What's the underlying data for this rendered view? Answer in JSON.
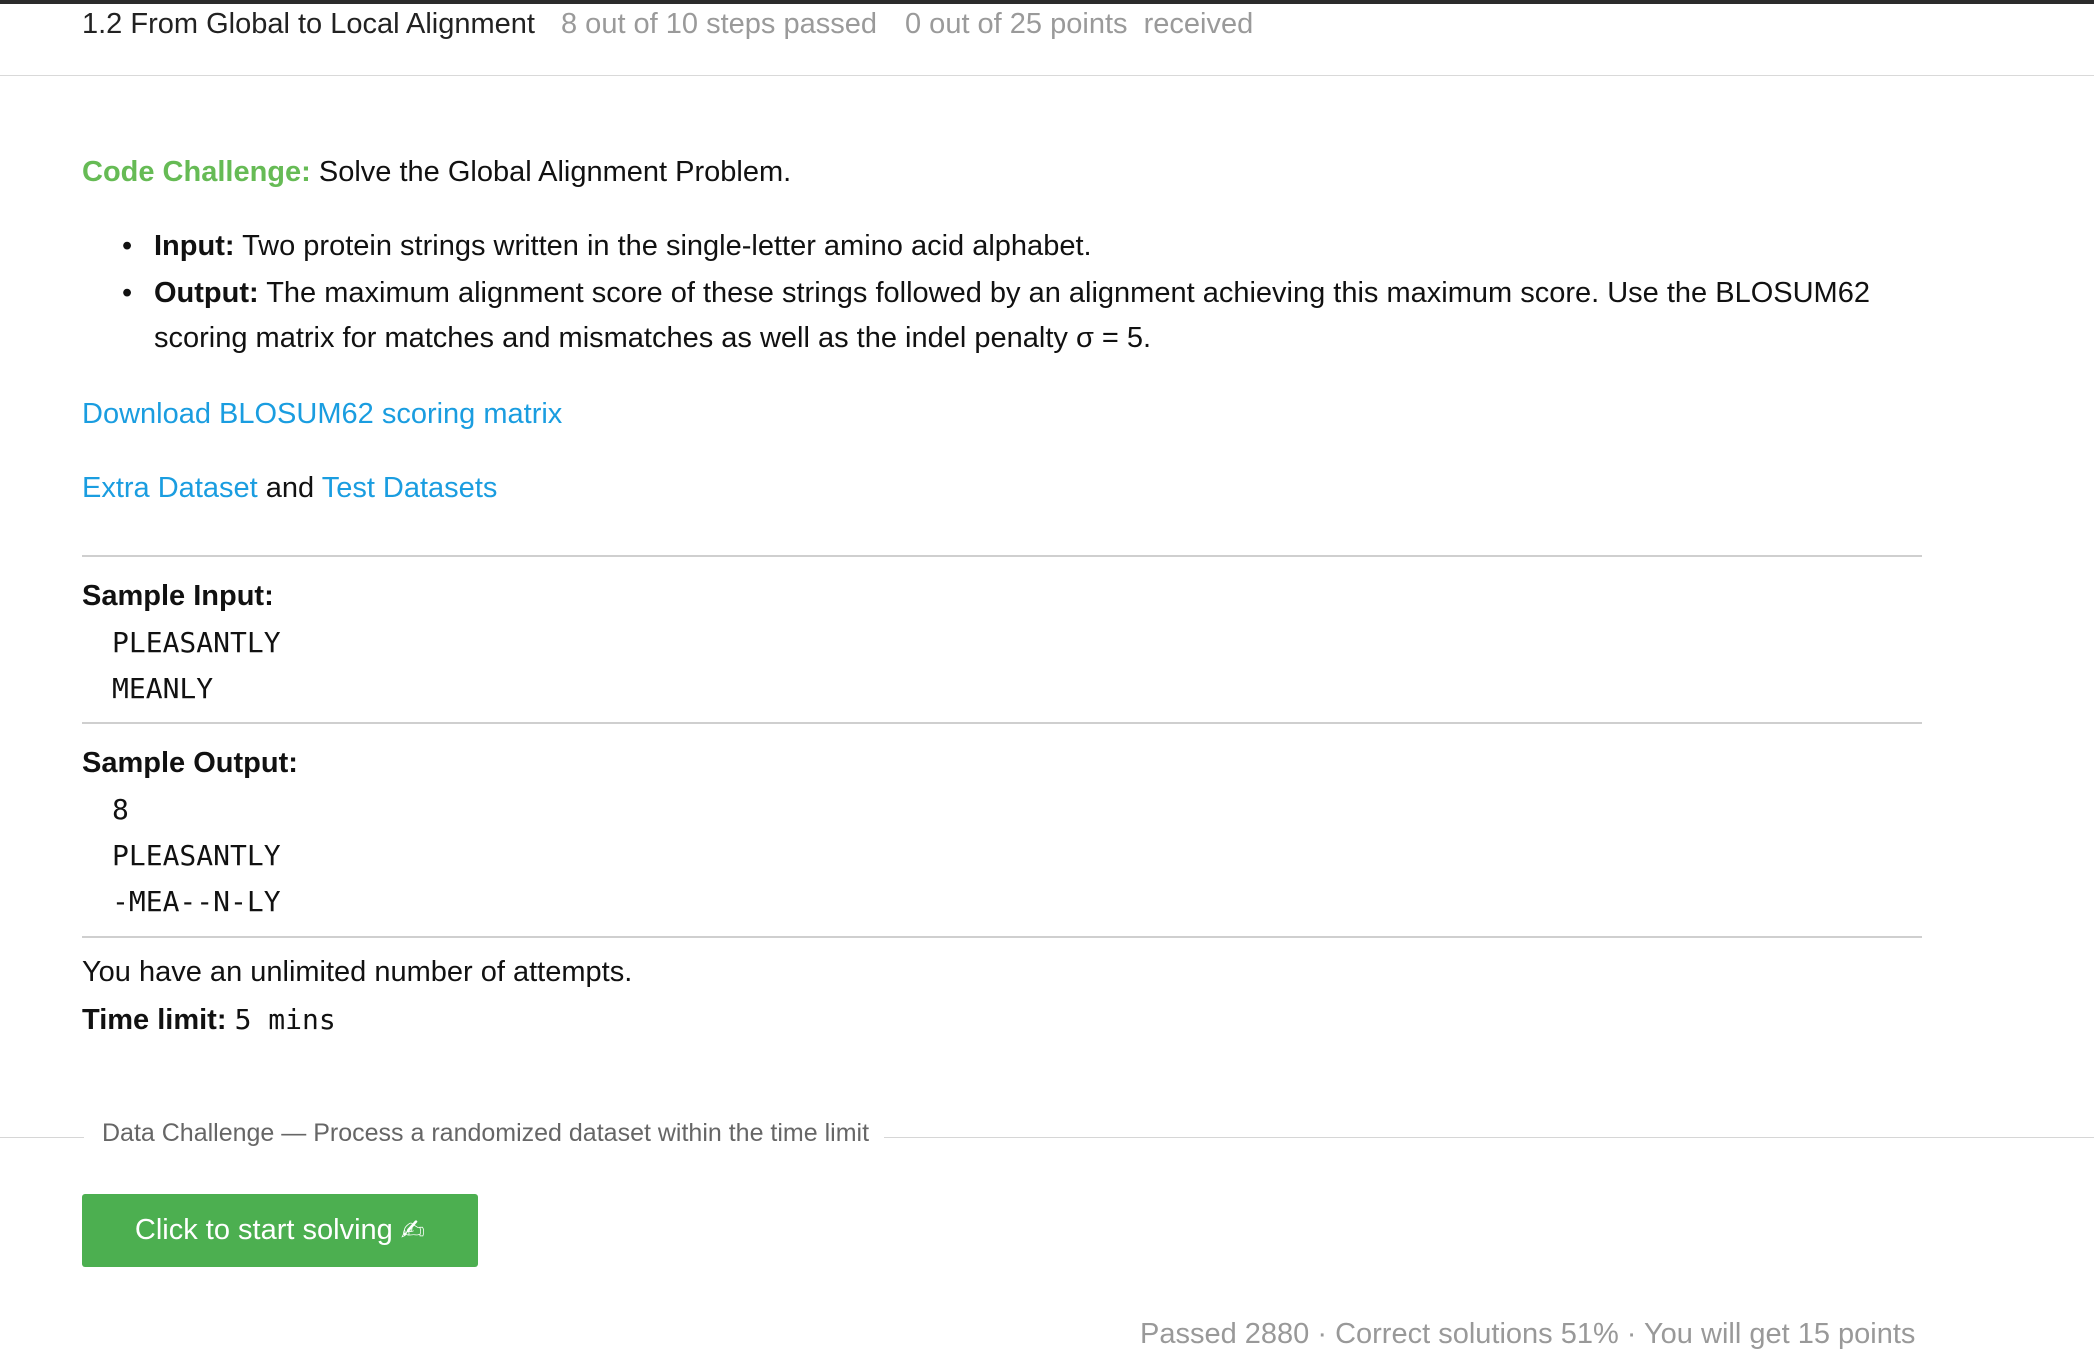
{
  "header": {
    "lesson_title": "1.2 From Global to Local Alignment",
    "steps_passed": "8 out of 10 steps passed",
    "points_received": "0 out of 25 points  received"
  },
  "challenge": {
    "label": "Code Challenge:",
    "text": "Solve the Global Alignment Problem.",
    "items": [
      {
        "label": "Input:",
        "text": "Two protein strings written in the single-letter amino acid alphabet."
      },
      {
        "label": "Output:",
        "text": "The maximum alignment score of these strings followed by an alignment achieving this maximum score. Use the BLOSUM62 scoring matrix for matches and mismatches as well as the indel penalty σ = 5."
      }
    ]
  },
  "links": {
    "download": "Download BLOSUM62 scoring matrix",
    "extra_dataset": "Extra Dataset",
    "and": "and",
    "test_datasets": "Test Datasets"
  },
  "sample_input": {
    "label": "Sample Input:",
    "lines": [
      "PLEASANTLY",
      "MEANLY"
    ]
  },
  "sample_output": {
    "label": "Sample Output:",
    "lines": [
      "8",
      "PLEASANTLY",
      "-MEA--N-LY"
    ]
  },
  "attempts_text": "You have an unlimited number of attempts.",
  "time_limit": {
    "label": "Time limit:",
    "value": "5 mins"
  },
  "data_challenge": {
    "divider_text": "Data Challenge — Process a randomized dataset within the time limit",
    "button_label": "Click to start solving",
    "button_icon": "writing-hand-icon"
  },
  "footer_partial": {
    "text": "Passed 2880 · Correct solutions 51% · You will get 15 points"
  },
  "colors": {
    "accent_green": "#66bb55",
    "link_blue": "#1a9de0",
    "button_green": "#4caf50"
  }
}
